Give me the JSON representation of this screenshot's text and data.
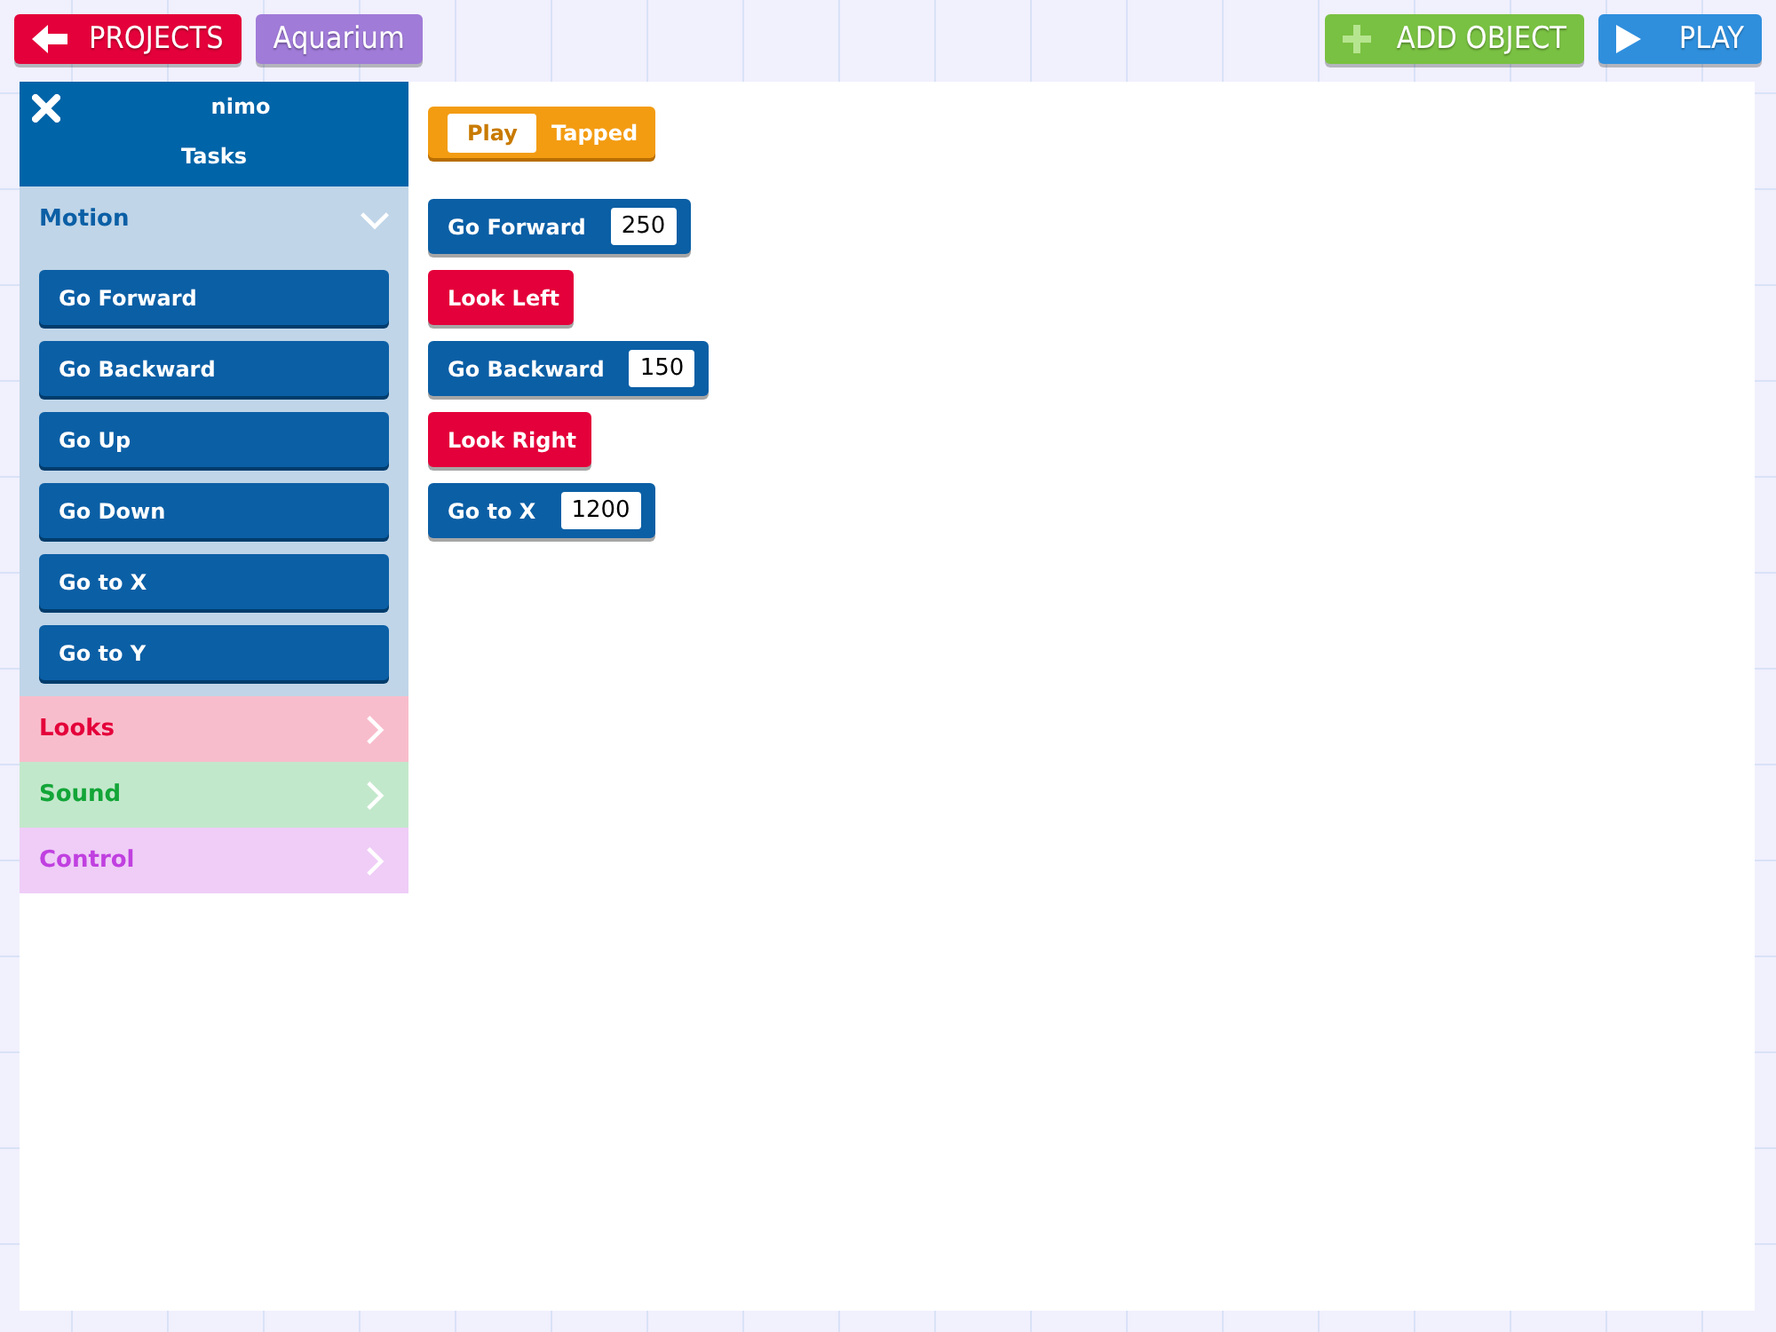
{
  "toolbar": {
    "back_button": "PROJECTS",
    "project_name": "Aquarium",
    "add_button": "ADD OBJECT",
    "play_button": "PLAY"
  },
  "sidebar": {
    "object_name": "nimo",
    "subtitle": "Tasks",
    "categories": [
      {
        "label": "Motion",
        "color": "#0b5fa5",
        "expanded": true,
        "blocks": [
          "Go Forward",
          "Go Backward",
          "Go Up",
          "Go Down",
          "Go to X",
          "Go to Y"
        ]
      },
      {
        "label": "Looks",
        "color": "#e4003a",
        "expanded": false
      },
      {
        "label": "Sound",
        "color": "#13a538",
        "expanded": false
      },
      {
        "label": "Control",
        "color": "#c040e0",
        "expanded": false
      }
    ]
  },
  "script": {
    "trigger": {
      "value": "Play",
      "label": "Tapped"
    },
    "blocks": [
      {
        "kind": "number",
        "label": "Go Forward",
        "value": "250",
        "color": "#0b5fa5"
      },
      {
        "kind": "plain",
        "label": "Look Left",
        "color": "#e4003a"
      },
      {
        "kind": "number",
        "label": "Go Backward",
        "value": "150",
        "color": "#0b5fa5"
      },
      {
        "kind": "plain",
        "label": "Look Right",
        "color": "#e4003a"
      },
      {
        "kind": "number",
        "label": "Go to X",
        "value": "1200",
        "color": "#0b5fa5"
      }
    ]
  }
}
